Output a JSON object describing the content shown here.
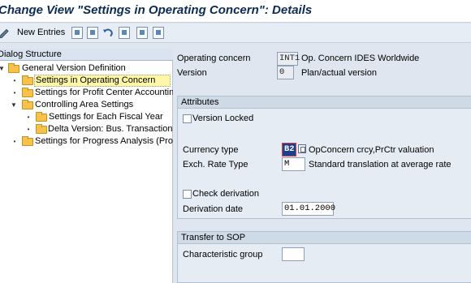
{
  "window": {
    "title": "Change View \"Settings in Operating Concern\": Details"
  },
  "toolbar": {
    "new_entries_label": "New Entries",
    "icons": [
      "edit-icon",
      "copy-icon",
      "delete-icon",
      "undo-icon",
      "select-all-icon",
      "save-icon",
      "deselect-icon"
    ]
  },
  "tree": {
    "header": "Dialog Structure",
    "nodes": [
      {
        "label": "General Version Definition",
        "expanded": true,
        "level": 0
      },
      {
        "label": "Settings in Operating Concern",
        "level": 1,
        "selected": true
      },
      {
        "label": "Settings for Profit Center Accounting",
        "level": 1
      },
      {
        "label": "Controlling Area Settings",
        "expanded": true,
        "level": 1
      },
      {
        "label": "Settings for Each Fiscal Year",
        "level": 2
      },
      {
        "label": "Delta Version: Bus. Transactions",
        "level": 2
      },
      {
        "label": "Settings for Progress Analysis (Project)",
        "level": 1
      }
    ]
  },
  "header_fields": {
    "operating_concern_label": "Operating concern",
    "operating_concern_value": "INT1",
    "operating_concern_text": "Op. Concern IDES Worldwide",
    "version_label": "Version",
    "version_value": "0",
    "version_text": "Plan/actual version"
  },
  "attributes": {
    "title": "Attributes",
    "version_locked_label": "Version Locked",
    "version_locked": false,
    "currency_type_label": "Currency type",
    "currency_type_value": "B2",
    "currency_type_text": "OpConcern crcy,PrCtr valuation",
    "exch_rate_label": "Exch. Rate Type",
    "exch_rate_value": "M",
    "exch_rate_text": "Standard translation at average rate",
    "check_derivation_label": "Check derivation",
    "check_derivation": false,
    "derivation_date_label": "Derivation date",
    "derivation_date_value": "01.01.2000"
  },
  "transfer_sop": {
    "title": "Transfer to SOP",
    "characteristic_group_label": "Characteristic group",
    "characteristic_group_value": ""
  }
}
